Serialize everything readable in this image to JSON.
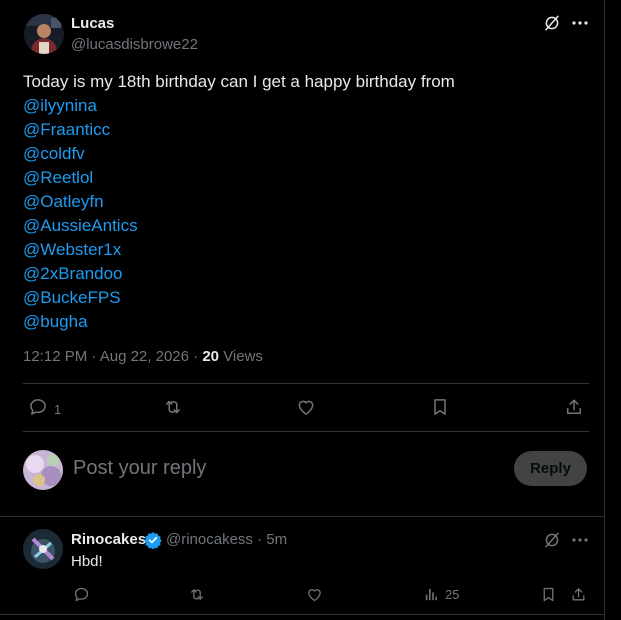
{
  "post": {
    "author_name": "Lucas",
    "author_handle": "@lucasdisbrowe22",
    "text_intro": "Today is my 18th birthday can I get a happy birthday from",
    "mentions": [
      "@ilyynina",
      "@Fraanticc",
      "@coldfv",
      "@Reetlol",
      "@Oatleyfn",
      "@AussieAntics",
      "@Webster1x",
      "@2xBrandoo",
      "@BuckeFPS",
      "@bugha"
    ],
    "time": "12:12 PM",
    "date": "Aug 22, 2026",
    "views_count": "20",
    "views_label": "Views",
    "reply_count": "1"
  },
  "composer": {
    "placeholder": "Post your reply",
    "reply_button": "Reply"
  },
  "reply": {
    "author_name": "Rinocakes",
    "author_handle": "@rinocakess",
    "time_ago": "5m",
    "text": "Hbd!",
    "views_count": "25"
  },
  "colors": {
    "background": "#000000",
    "text": "#e7e9ea",
    "muted": "#71767b",
    "accent": "#1d9bf0",
    "divider": "#2f3336"
  },
  "icons": [
    "grok-icon",
    "more-icon",
    "reply-icon",
    "repost-icon",
    "like-icon",
    "bookmark-icon",
    "share-icon",
    "analytics-icon",
    "verified-badge-icon"
  ]
}
